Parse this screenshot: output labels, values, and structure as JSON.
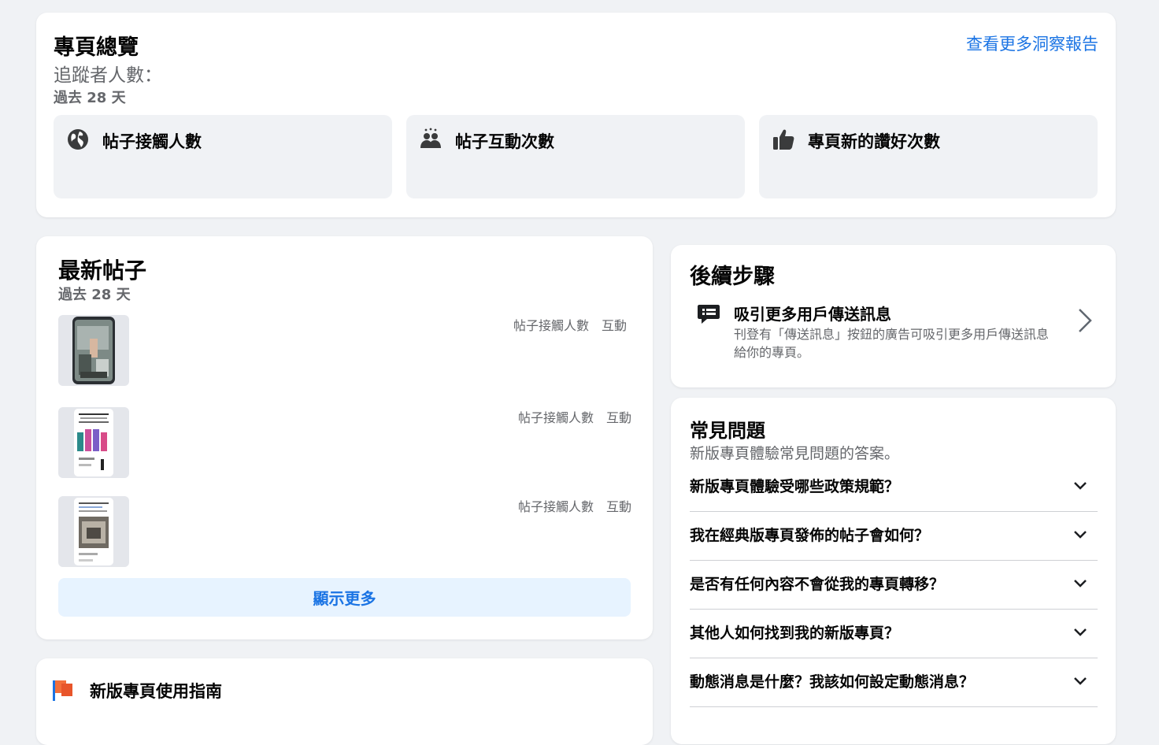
{
  "overview": {
    "title": "專頁總覽",
    "followers_label": "追蹤者人數：",
    "period": "過去 28 天",
    "more_insights_link": "查看更多洞察報告",
    "metrics": [
      {
        "label": "帖子接觸人數",
        "icon": "globe-icon"
      },
      {
        "label": "帖子互動次數",
        "icon": "people-icon"
      },
      {
        "label": "專頁新的讚好次數",
        "icon": "thumbs-up-icon"
      }
    ]
  },
  "latest_posts": {
    "title": "最新帖子",
    "period": "過去 28 天",
    "posts": [
      {
        "reach_label": "帖子接觸人數",
        "engagement_label": "互動"
      },
      {
        "reach_label": "帖子接觸人數",
        "engagement_label": "互動"
      },
      {
        "reach_label": "帖子接觸人數",
        "engagement_label": "互動"
      }
    ],
    "show_more": "顯示更多"
  },
  "guide": {
    "label": "新版專頁使用指南",
    "icon": "flag-icon"
  },
  "next_steps": {
    "title": "後續步驟",
    "item": {
      "title": "吸引更多用戶傳送訊息",
      "description": "刊登有「傳送訊息」按鈕的廣告可吸引更多用戶傳送訊息給你的專頁。",
      "icon": "message-icon"
    }
  },
  "faq": {
    "title": "常見問題",
    "subtitle": "新版專頁體驗常見問題的答案。",
    "items": [
      "新版專頁體驗受哪些政策規範？",
      "我在經典版專頁發佈的帖子會如何？",
      "是否有任何內容不會從我的專頁轉移？",
      "其他人如何找到我的新版專頁？",
      "動態消息是什麼？我該如何設定動態消息？"
    ]
  },
  "colors": {
    "accent": "#1b74e4",
    "background": "#f0f2f5",
    "secondary_text": "#65676b"
  }
}
